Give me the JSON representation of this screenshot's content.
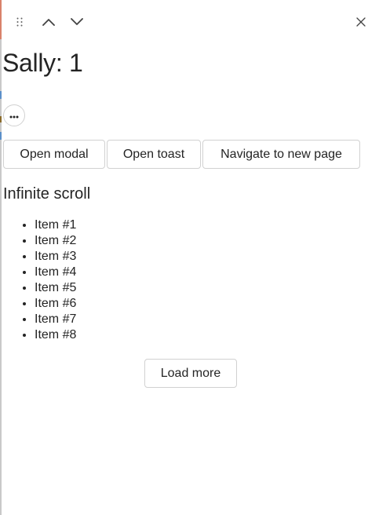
{
  "header": {
    "drag_icon": "drag-grip-icon",
    "up_icon": "chevron-up-icon",
    "down_icon": "chevron-down-icon",
    "close_icon": "close-icon"
  },
  "main": {
    "title": "Sally: 1",
    "more_icon": "more-horizontal-icon",
    "buttons": {
      "open_modal": "Open modal",
      "open_toast": "Open toast",
      "navigate": "Navigate to new page"
    },
    "section_heading": "Infinite scroll",
    "items": [
      "Item #1",
      "Item #2",
      "Item #3",
      "Item #4",
      "Item #5",
      "Item #6",
      "Item #7",
      "Item #8"
    ],
    "load_more": "Load more"
  },
  "colors": {
    "backdrop_accent": "#d9826b",
    "backdrop_mark": "#5b8fc9",
    "border": "#d1d1d1",
    "text": "#242424"
  }
}
